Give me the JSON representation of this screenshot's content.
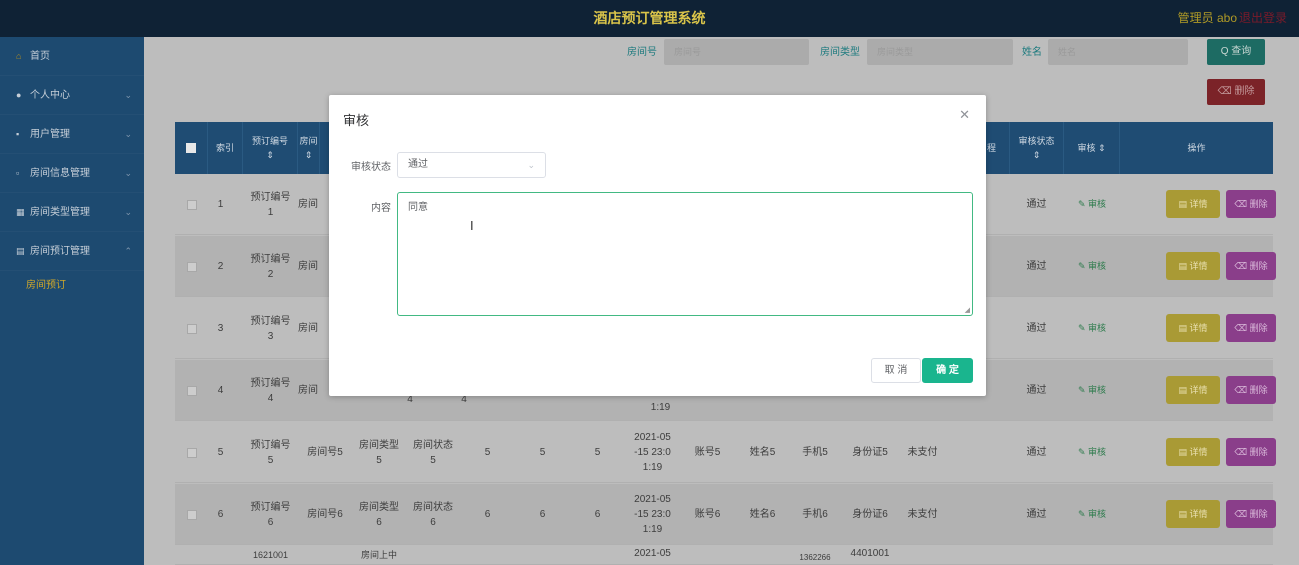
{
  "header": {
    "title": "酒店预订管理系统",
    "admin": "管理员 abo",
    "logout": "退出登录"
  },
  "sidebar": {
    "items": [
      {
        "label": "首页",
        "icon": "home-icon"
      },
      {
        "label": "个人中心",
        "icon": "user-icon"
      },
      {
        "label": "用户管理",
        "icon": "users-icon"
      },
      {
        "label": "房间信息管理",
        "icon": "room-icon"
      },
      {
        "label": "房间类型管理",
        "icon": "grid-icon"
      },
      {
        "label": "房间预订管理",
        "icon": "booking-icon"
      }
    ],
    "sub_item": "房间预订"
  },
  "search": {
    "room_no_label": "房间号",
    "room_no_placeholder": "房间号",
    "room_type_label": "房间类型",
    "room_type_placeholder": "房间类型",
    "name_label": "姓名",
    "name_placeholder": "姓名",
    "search_button": "Q 查询",
    "delete_button": "删除"
  },
  "table": {
    "headers": [
      "索引",
      "预订编号",
      "房间",
      "审核状态",
      "审核"
    ],
    "header_partial": "程",
    "header_action": "操作",
    "audit_link": "审核",
    "detail_button": "详情",
    "delete_button": "删除",
    "rows": [
      {
        "idx": "1",
        "code1": "预订编号",
        "code2": "1",
        "room": "房间",
        "status": "通过"
      },
      {
        "idx": "2",
        "code1": "预订编号",
        "code2": "2",
        "room": "房间",
        "status": "通过"
      },
      {
        "idx": "3",
        "code1": "预订编号",
        "code2": "3",
        "room": "房间",
        "status": "通过"
      },
      {
        "idx": "4",
        "code1": "预订编号",
        "code2": "4",
        "room": "房间",
        "status": "通过",
        "t3": "4",
        "t4": "4",
        "time_tail": "1:19"
      },
      {
        "idx": "5",
        "code1": "预订编号",
        "code2": "5",
        "room": "房间号5",
        "type1": "房间类型",
        "type2": "5",
        "st1": "房间状态",
        "st2": "5",
        "n1": "5",
        "n2": "5",
        "n3": "5",
        "time1": "2021-05",
        "time2": "-15 23:0",
        "time3": "1:19",
        "account": "账号5",
        "name": "姓名5",
        "phone": "手机5",
        "idcard": "身份证5",
        "pay": "未支付",
        "status": "通过"
      },
      {
        "idx": "6",
        "code1": "预订编号",
        "code2": "6",
        "room": "房间号6",
        "type1": "房间类型",
        "type2": "6",
        "st1": "房间状态",
        "st2": "6",
        "n1": "6",
        "n2": "6",
        "n3": "6",
        "time1": "2021-05",
        "time2": "-15 23:0",
        "time3": "1:19",
        "account": "账号6",
        "name": "姓名6",
        "phone": "手机6",
        "idcard": "身份证6",
        "pay": "未支付",
        "status": "通过"
      }
    ],
    "partial_row": {
      "c1": "1621001",
      "c2": "房间上中",
      "time": "2021-05",
      "c3": "1362266",
      "c4": "4401001"
    }
  },
  "modal": {
    "title": "审核",
    "status_label": "审核状态",
    "status_value": "通过",
    "content_label": "内容",
    "content_value": "同意",
    "cancel": "取 消",
    "confirm": "确 定"
  },
  "colors": {
    "accent": "#1ab58e",
    "header_bg": "#0f2235",
    "sidebar_bg": "#1d4a70"
  }
}
